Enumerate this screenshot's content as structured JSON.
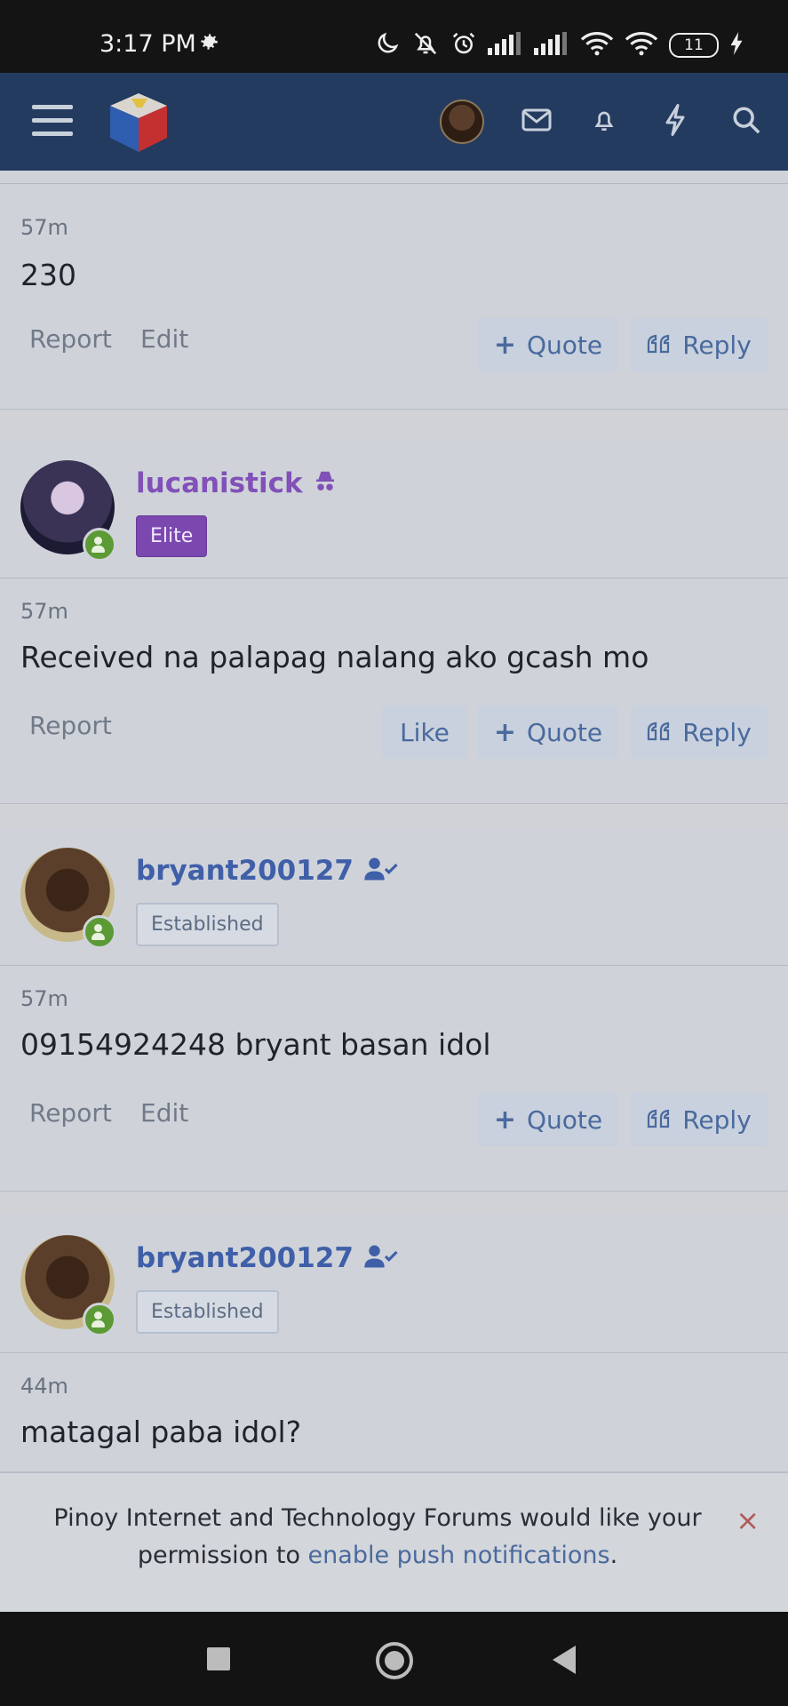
{
  "status_bar": {
    "time": "3:17 PM",
    "battery": "11"
  },
  "header": {
    "logo": "pinoy-forum-cube-logo"
  },
  "posts": [
    {
      "time": "57m",
      "message": "230",
      "actions": {
        "report": "Report",
        "edit": "Edit"
      },
      "buttons": {
        "quote": "Quote",
        "reply": "Reply"
      }
    },
    {
      "username": "lucanistick",
      "username_color": "#8150b8",
      "badge": "Elite",
      "time": "57m",
      "message": "Received na palapag nalang ako gcash mo",
      "actions": {
        "report": "Report"
      },
      "buttons": {
        "like": "Like",
        "quote": "Quote",
        "reply": "Reply"
      }
    },
    {
      "username": "bryant200127",
      "username_color": "#3f5fa8",
      "badge": "Established",
      "time": "57m",
      "message": "09154924248 bryant basan idol",
      "actions": {
        "report": "Report",
        "edit": "Edit"
      },
      "buttons": {
        "quote": "Quote",
        "reply": "Reply"
      }
    },
    {
      "username": "bryant200127",
      "username_color": "#3f5fa8",
      "badge": "Established",
      "time": "44m",
      "message": "matagal paba idol?"
    }
  ],
  "notice": {
    "text_before": "Pinoy Internet and Technology Forums would like your permission to ",
    "link": "enable push notifications",
    "text_after": ".",
    "close": "×"
  }
}
